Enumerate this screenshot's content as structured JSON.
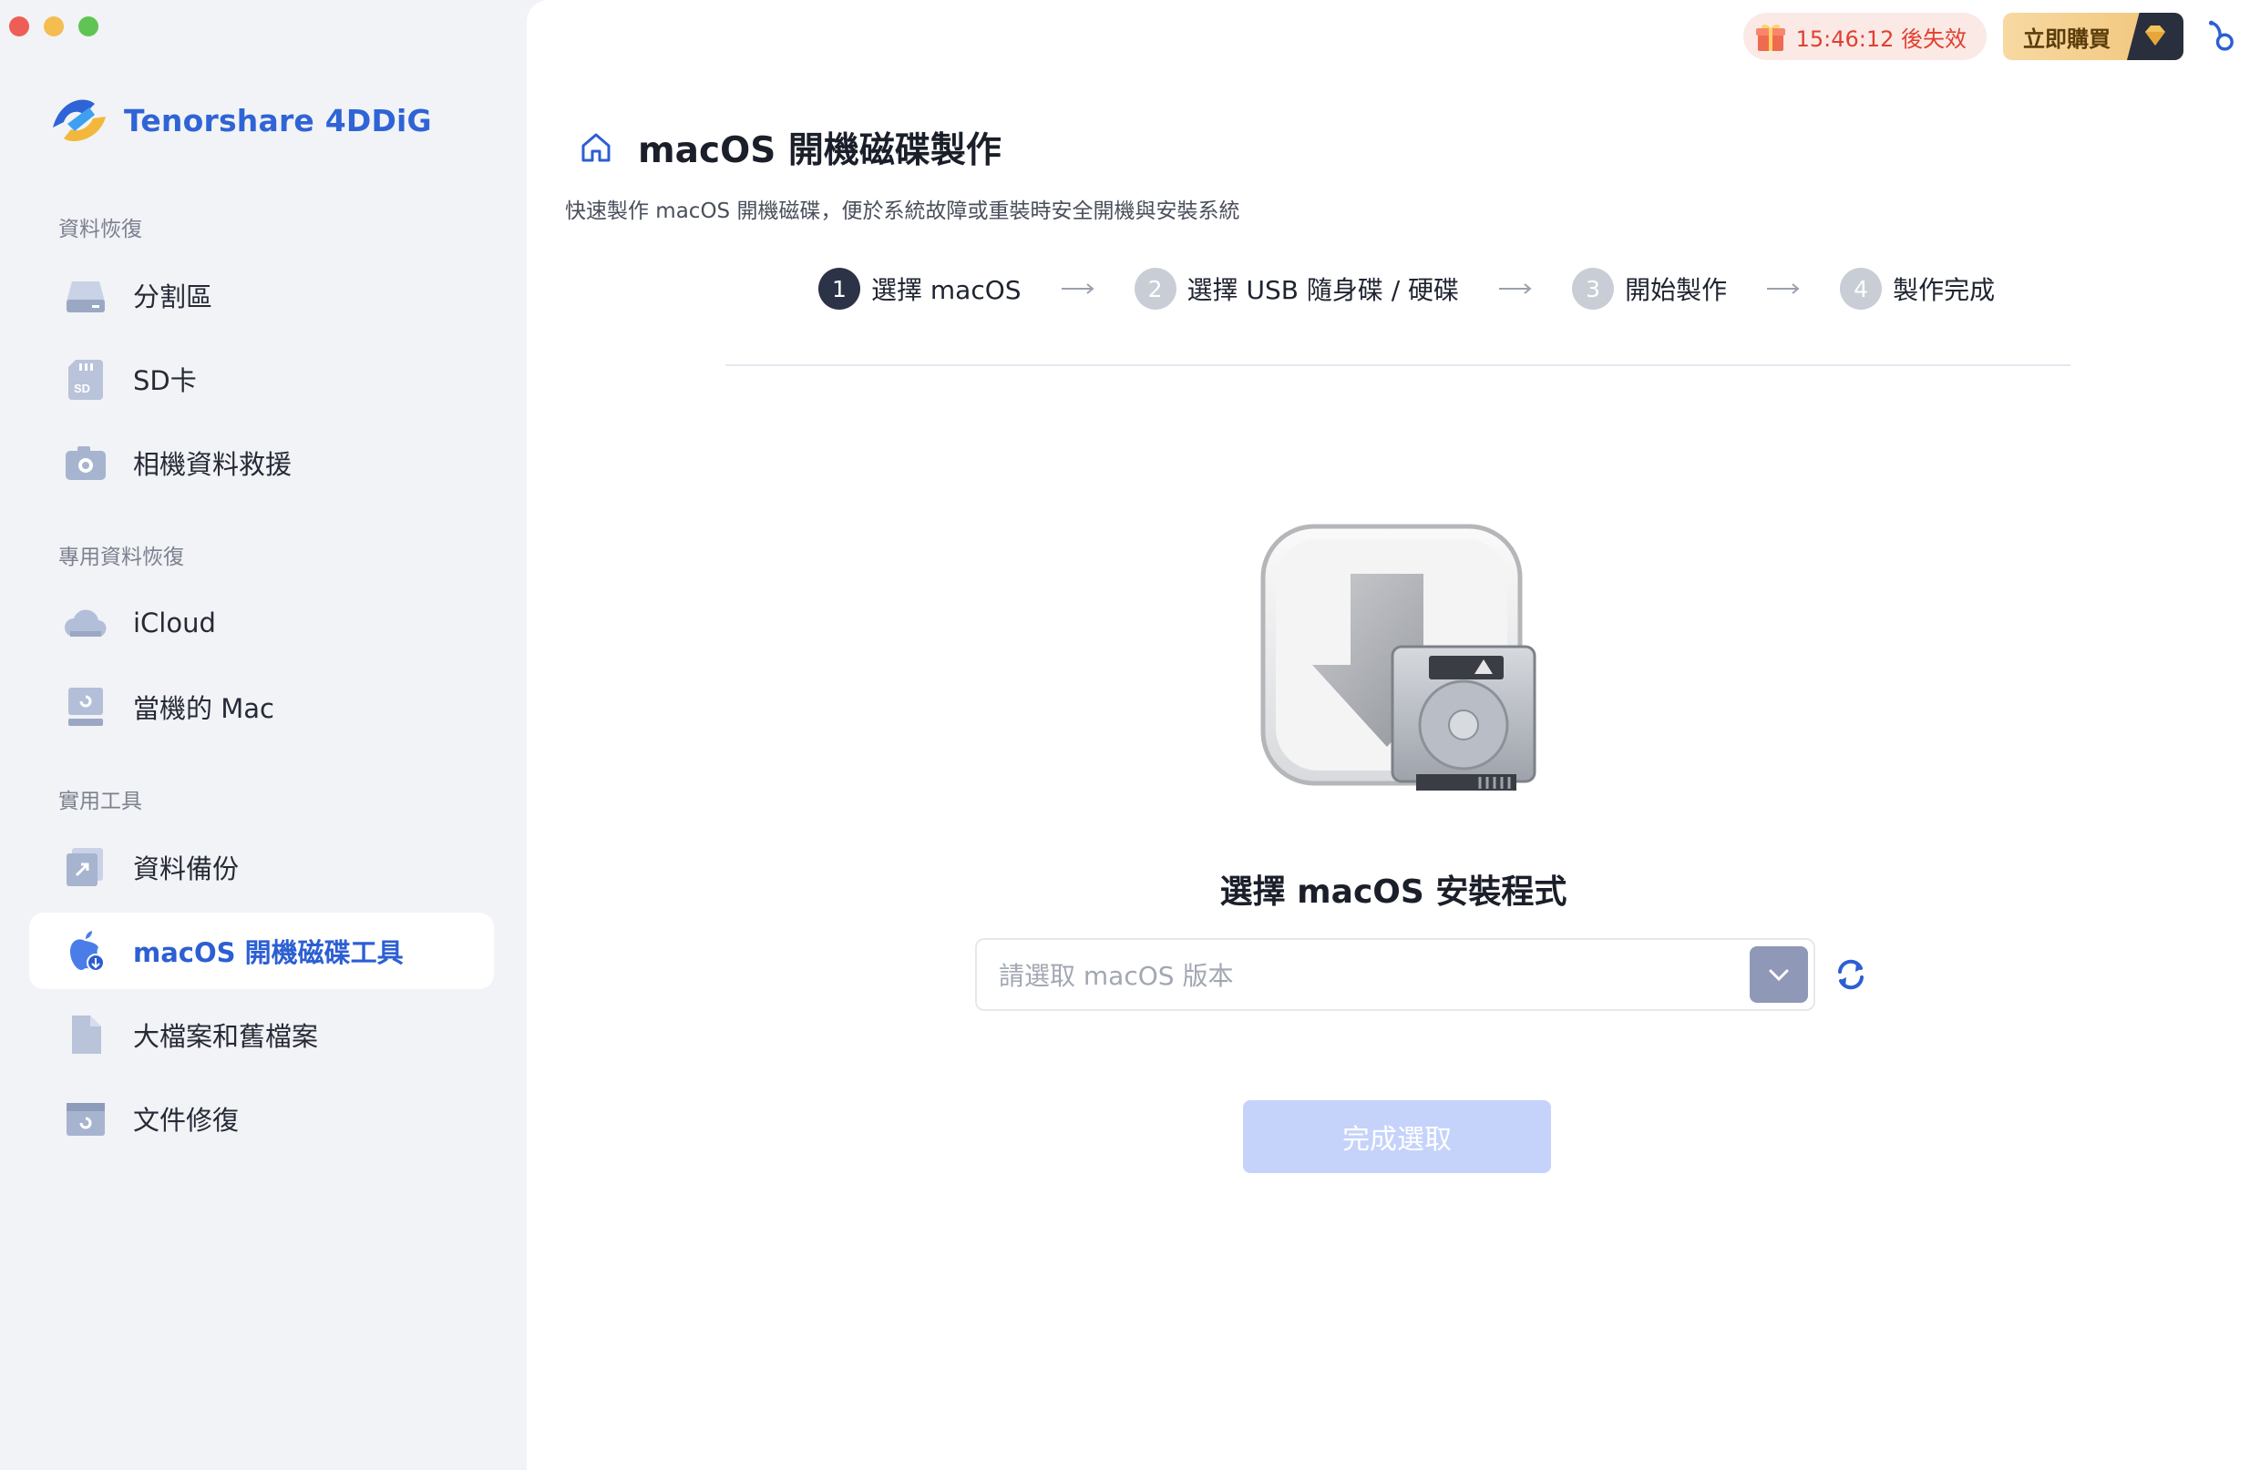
{
  "window": {
    "traffic_lights": [
      "close",
      "minimize",
      "zoom"
    ]
  },
  "brand": {
    "name": "Tenorshare 4DDiG",
    "logo_icon": "4ddig-logo-icon"
  },
  "sidebar": {
    "sections": [
      {
        "label": "資料恢復",
        "items": [
          {
            "label": "分割區",
            "icon": "drive-icon"
          },
          {
            "label": "SD卡",
            "icon": "sd-card-icon"
          },
          {
            "label": "相機資料救援",
            "icon": "camera-icon"
          }
        ]
      },
      {
        "label": "專用資料恢復",
        "items": [
          {
            "label": "iCloud",
            "icon": "cloud-icon"
          },
          {
            "label": "當機的 Mac",
            "icon": "crashed-mac-icon"
          }
        ]
      },
      {
        "label": "實用工具",
        "items": [
          {
            "label": "資料備份",
            "icon": "backup-icon"
          },
          {
            "label": "macOS 開機磁碟工具",
            "icon": "apple-boot-icon",
            "active": true
          },
          {
            "label": "大檔案和舊檔案",
            "icon": "file-icon"
          },
          {
            "label": "文件修復",
            "icon": "document-repair-icon"
          }
        ]
      }
    ]
  },
  "topbar": {
    "timer_text": "15:46:12 後失效",
    "buy_label": "立即購買",
    "colors": {
      "timer": "#e0402f",
      "buy_bg": "#f1c477"
    }
  },
  "page": {
    "title": "macOS 開機磁碟製作",
    "subtitle": "快速製作 macOS 開機磁碟，便於系統故障或重裝時安全開機與安裝系統"
  },
  "steps": [
    {
      "num": "1",
      "label": "選擇 macOS",
      "active": true
    },
    {
      "num": "2",
      "label": "選擇 USB 隨身碟 / 硬碟",
      "active": false
    },
    {
      "num": "3",
      "label": "開始製作",
      "active": false
    },
    {
      "num": "4",
      "label": "製作完成",
      "active": false
    }
  ],
  "selector": {
    "title": "選擇 macOS 安裝程式",
    "placeholder": "請選取 macOS 版本",
    "confirm_label": "完成選取",
    "confirm_enabled": false
  },
  "colors": {
    "accent": "#2c5fd3",
    "sidebar_bg": "#f2f3f6",
    "button_disabled": "#c5d3fb"
  }
}
